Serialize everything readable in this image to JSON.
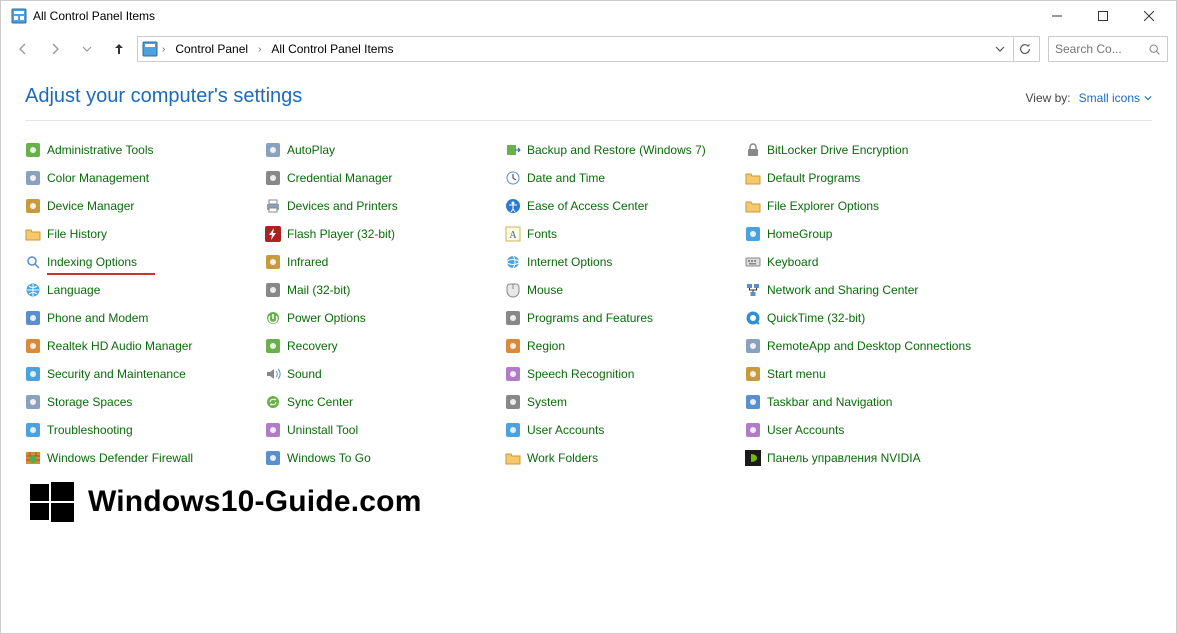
{
  "window": {
    "title": "All Control Panel Items"
  },
  "breadcrumb": {
    "root": "Control Panel",
    "current": "All Control Panel Items"
  },
  "search": {
    "placeholder": "Search Co..."
  },
  "header": {
    "heading": "Adjust your computer's settings",
    "viewby_label": "View by:",
    "viewby_value": "Small icons"
  },
  "items": [
    {
      "label": "Administrative Tools",
      "icon": "admin-tools-icon"
    },
    {
      "label": "AutoPlay",
      "icon": "autoplay-icon"
    },
    {
      "label": "Backup and Restore (Windows 7)",
      "icon": "backup-icon"
    },
    {
      "label": "BitLocker Drive Encryption",
      "icon": "bitlocker-icon"
    },
    {
      "label": "Color Management",
      "icon": "color-mgmt-icon"
    },
    {
      "label": "Credential Manager",
      "icon": "credential-icon"
    },
    {
      "label": "Date and Time",
      "icon": "clock-icon"
    },
    {
      "label": "Default Programs",
      "icon": "default-programs-icon"
    },
    {
      "label": "Device Manager",
      "icon": "device-mgr-icon"
    },
    {
      "label": "Devices and Printers",
      "icon": "printer-icon"
    },
    {
      "label": "Ease of Access Center",
      "icon": "ease-access-icon"
    },
    {
      "label": "File Explorer Options",
      "icon": "folder-options-icon"
    },
    {
      "label": "File History",
      "icon": "file-history-icon"
    },
    {
      "label": "Flash Player (32-bit)",
      "icon": "flash-icon"
    },
    {
      "label": "Fonts",
      "icon": "fonts-icon"
    },
    {
      "label": "HomeGroup",
      "icon": "homegroup-icon"
    },
    {
      "label": "Indexing Options",
      "icon": "indexing-icon",
      "highlighted": true
    },
    {
      "label": "Infrared",
      "icon": "infrared-icon"
    },
    {
      "label": "Internet Options",
      "icon": "internet-icon"
    },
    {
      "label": "Keyboard",
      "icon": "keyboard-icon"
    },
    {
      "label": "Language",
      "icon": "language-icon"
    },
    {
      "label": "Mail (32-bit)",
      "icon": "mail-icon"
    },
    {
      "label": "Mouse",
      "icon": "mouse-icon"
    },
    {
      "label": "Network and Sharing Center",
      "icon": "network-icon"
    },
    {
      "label": "Phone and Modem",
      "icon": "phone-icon"
    },
    {
      "label": "Power Options",
      "icon": "power-icon"
    },
    {
      "label": "Programs and Features",
      "icon": "programs-icon"
    },
    {
      "label": "QuickTime (32-bit)",
      "icon": "quicktime-icon"
    },
    {
      "label": "Realtek HD Audio Manager",
      "icon": "realtek-icon"
    },
    {
      "label": "Recovery",
      "icon": "recovery-icon"
    },
    {
      "label": "Region",
      "icon": "region-icon"
    },
    {
      "label": "RemoteApp and Desktop Connections",
      "icon": "remoteapp-icon"
    },
    {
      "label": "Security and Maintenance",
      "icon": "security-icon"
    },
    {
      "label": "Sound",
      "icon": "sound-icon"
    },
    {
      "label": "Speech Recognition",
      "icon": "speech-icon"
    },
    {
      "label": "Start menu",
      "icon": "startmenu-icon"
    },
    {
      "label": "Storage Spaces",
      "icon": "storage-icon"
    },
    {
      "label": "Sync Center",
      "icon": "sync-icon"
    },
    {
      "label": "System",
      "icon": "system-icon"
    },
    {
      "label": "Taskbar and Navigation",
      "icon": "taskbar-icon"
    },
    {
      "label": "Troubleshooting",
      "icon": "troubleshoot-icon"
    },
    {
      "label": "Uninstall Tool",
      "icon": "uninstall-icon"
    },
    {
      "label": "User Accounts",
      "icon": "user-accounts-icon"
    },
    {
      "label": "User Accounts",
      "icon": "user-accounts2-icon"
    },
    {
      "label": "Windows Defender Firewall",
      "icon": "firewall-icon"
    },
    {
      "label": "Windows To Go",
      "icon": "windowstogo-icon"
    },
    {
      "label": "Work Folders",
      "icon": "workfolders-icon"
    },
    {
      "label": "Панель управления NVIDIA",
      "icon": "nvidia-icon"
    }
  ],
  "watermark": {
    "text": "Windows10-Guide.com"
  }
}
